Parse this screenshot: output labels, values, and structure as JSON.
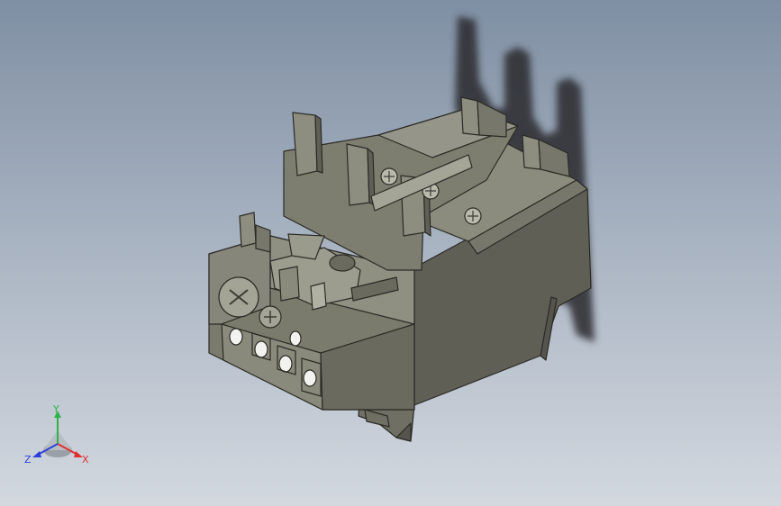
{
  "viewport": {
    "background_top": "#7f8fa3",
    "background_bottom": "#d3d8df",
    "model_colors": {
      "top_face": "#8c8c7e",
      "front_face": "#7b7b6d",
      "side_face": "#5f5f56",
      "edge": "#2b2b26",
      "shadow": "#2a2a2e"
    }
  },
  "triad": {
    "x_label": "X",
    "y_label": "Y",
    "z_label": "Z",
    "x_color": "#e03030",
    "y_color": "#2fb34a",
    "z_color": "#2f3fd9"
  }
}
